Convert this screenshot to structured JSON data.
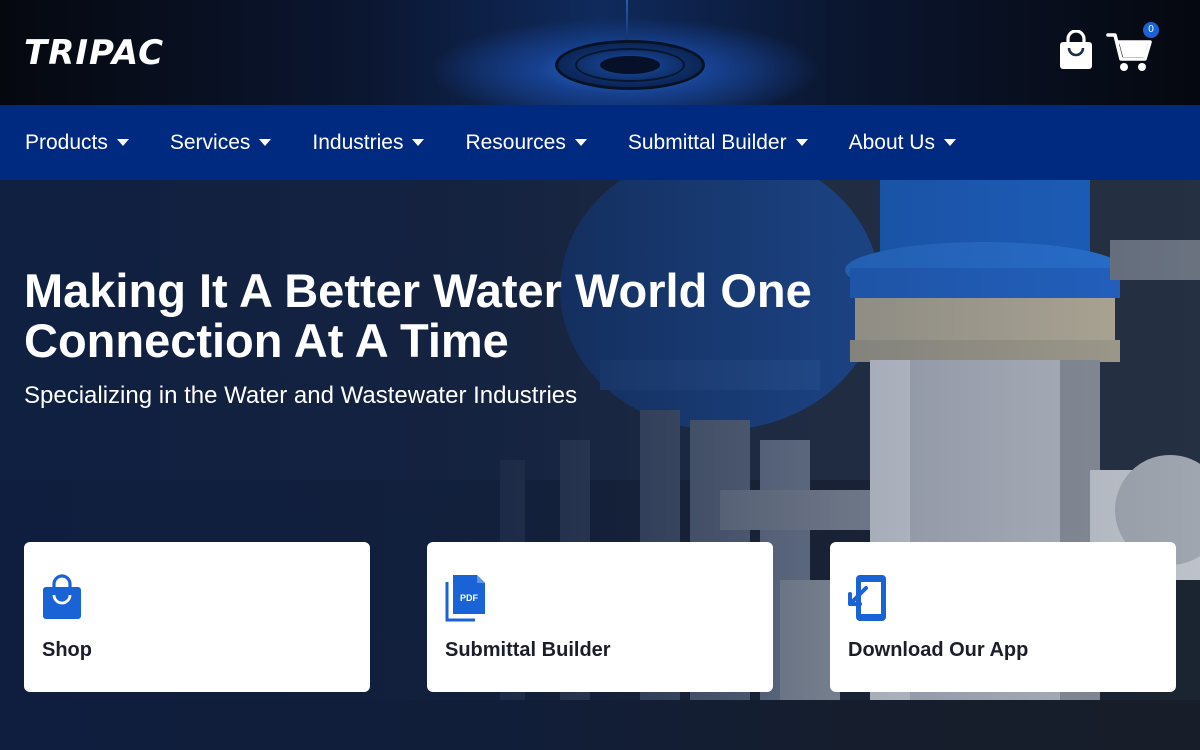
{
  "header": {
    "logo_text": "TRIPAC",
    "cart_count": "0",
    "icons": {
      "shop": "shopping-bag-icon",
      "cart": "cart-icon"
    }
  },
  "nav": {
    "items": [
      {
        "label": "Products"
      },
      {
        "label": "Services"
      },
      {
        "label": "Industries"
      },
      {
        "label": "Resources"
      },
      {
        "label": "Submittal Builder"
      },
      {
        "label": "About Us"
      }
    ]
  },
  "hero": {
    "title": "Making It A Better Water World One Connection At A Time",
    "subtitle": "Specializing in the Water and Wastewater Industries"
  },
  "cards": [
    {
      "label": "Shop",
      "icon": "shopping-bag-icon"
    },
    {
      "label": "Submittal Builder",
      "icon": "pdf-file-icon",
      "icon_text": "PDF"
    },
    {
      "label": "Download Our App",
      "icon": "mobile-download-icon"
    }
  ],
  "colors": {
    "nav_bg": "#002a80",
    "accent": "#1a63d6",
    "card_text": "#1b1e2a"
  }
}
